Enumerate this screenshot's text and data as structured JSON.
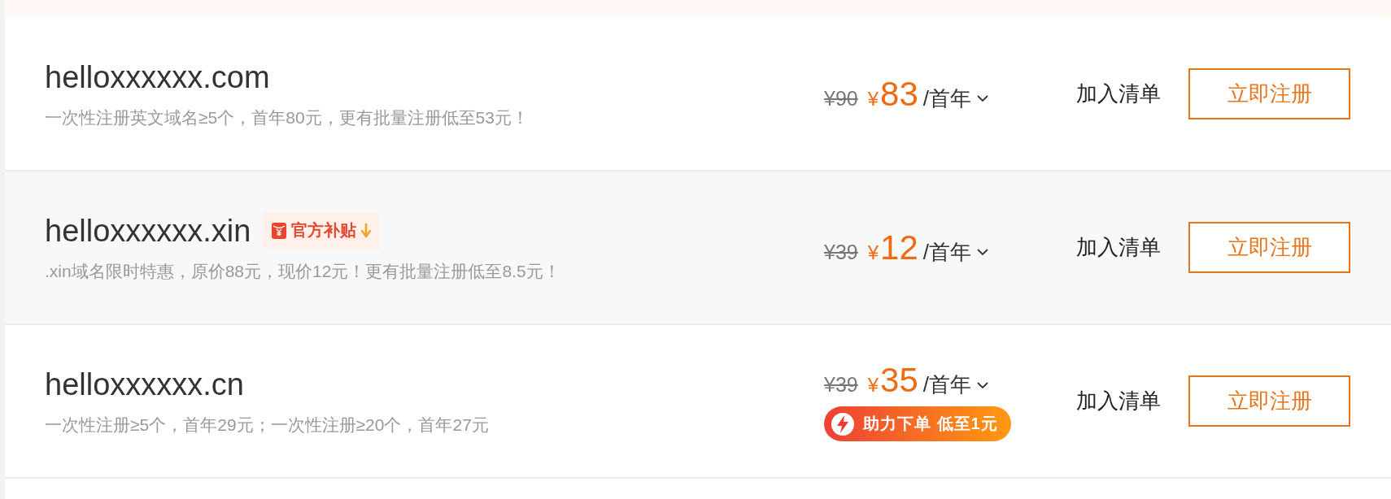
{
  "rows": [
    {
      "domain": "helloxxxxxx.com",
      "description": "一次性注册英文域名≥5个，首年80元，更有批量注册低至53元！",
      "original_price": "¥90",
      "currency": "¥",
      "price": "83",
      "unit": "/首年",
      "add_to_list": "加入清单",
      "register": "立即注册",
      "color": "#ffffff"
    },
    {
      "domain": "helloxxxxxx.xin",
      "tag": "官方补贴",
      "description": ".xin域名限时特惠，原价88元，现价12元！更有批量注册低至8.5元！",
      "original_price": "¥39",
      "currency": "¥",
      "price": "12",
      "unit": "/首年",
      "add_to_list": "加入清单",
      "register": "立即注册",
      "color": "#f8f8f8"
    },
    {
      "domain": "helloxxxxxx.cn",
      "description": "一次性注册≥5个，首年29元；一次性注册≥20个，首年27元",
      "original_price": "¥39",
      "currency": "¥",
      "price": "35",
      "unit": "/首年",
      "promo": "助力下单 低至1元",
      "add_to_list": "加入清单",
      "register": "立即注册",
      "color": "#ffffff"
    }
  ]
}
